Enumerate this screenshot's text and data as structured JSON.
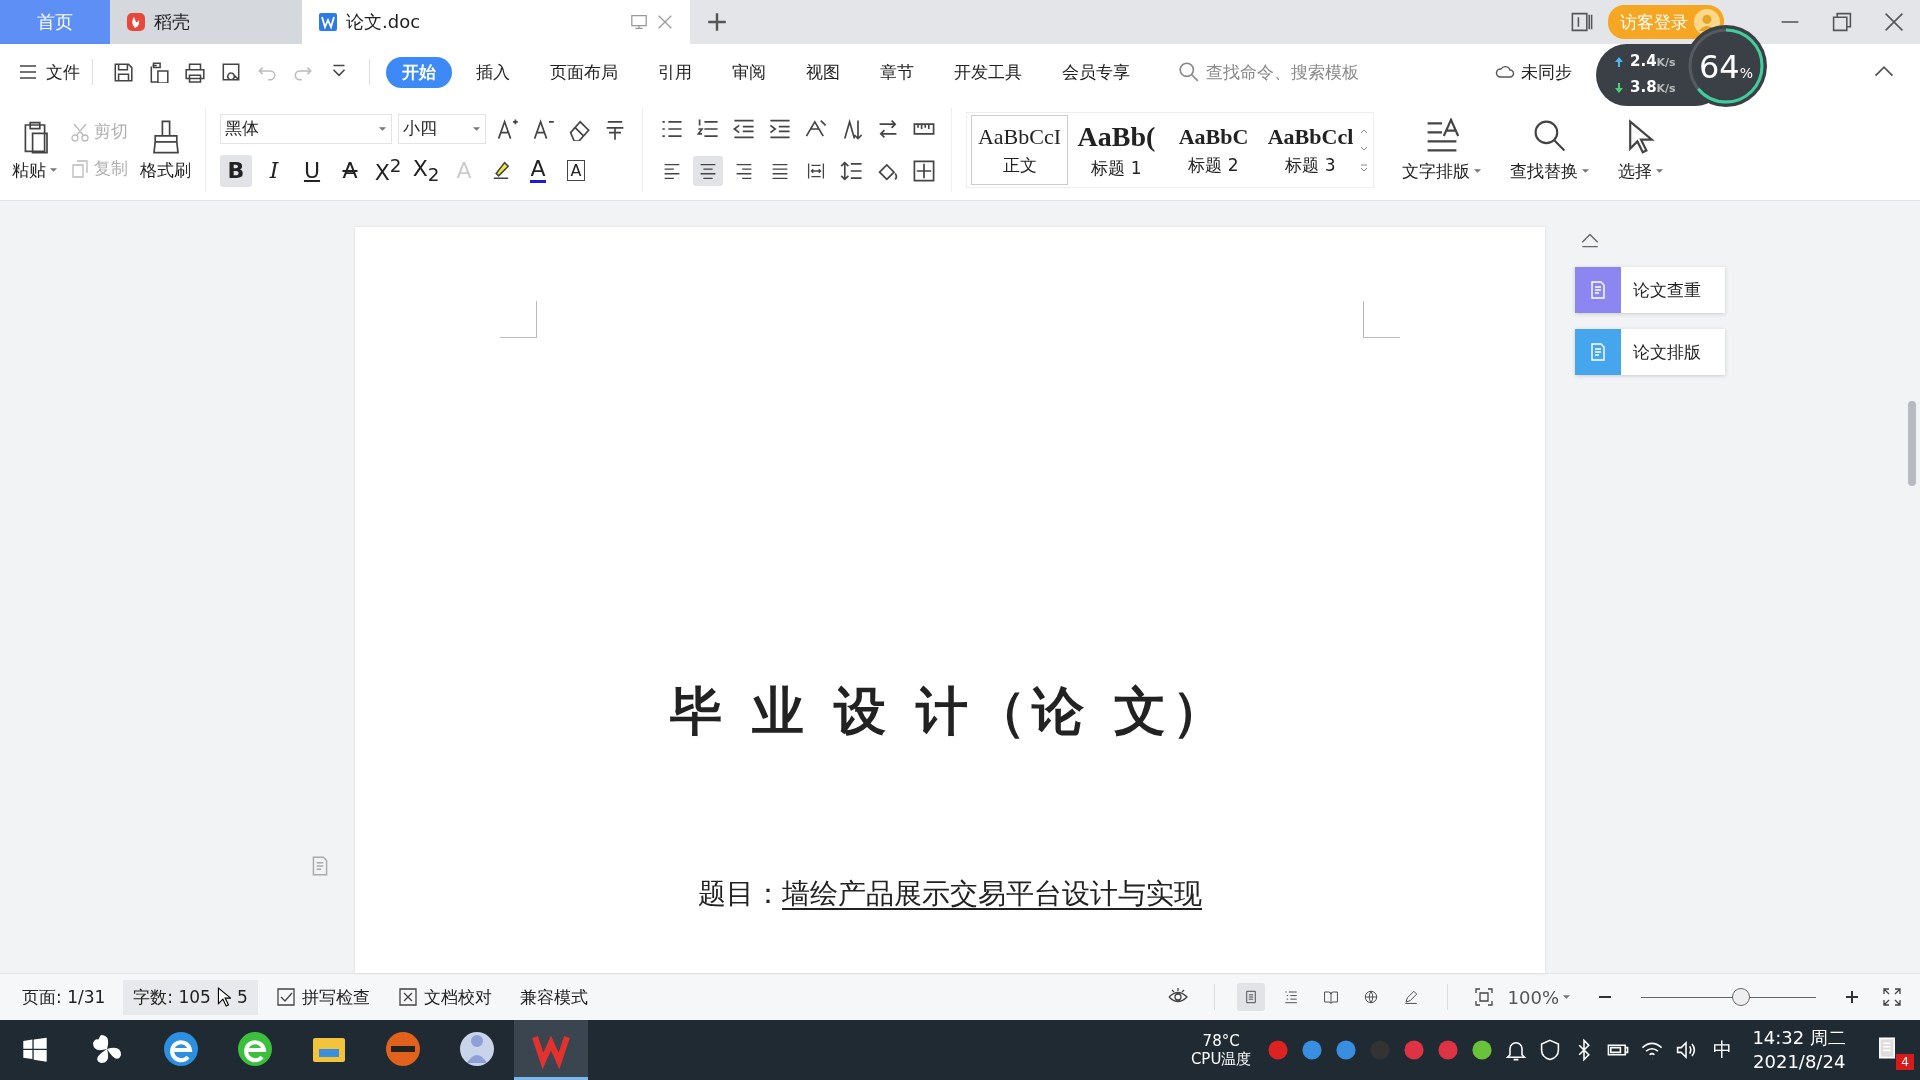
{
  "tabs": [
    {
      "kind": "home",
      "label": "首页",
      "selected": false
    },
    {
      "kind": "docer",
      "label": "稻壳",
      "selected": false
    },
    {
      "kind": "doc",
      "label": "论文.doc",
      "selected": true
    }
  ],
  "login": "访客登录",
  "menu": {
    "file": "文件",
    "tabs": [
      {
        "label": "开始",
        "selected": true
      },
      {
        "label": "插入",
        "selected": false
      },
      {
        "label": "页面布局",
        "selected": false
      },
      {
        "label": "引用",
        "selected": false
      },
      {
        "label": "审阅",
        "selected": false
      },
      {
        "label": "视图",
        "selected": false
      },
      {
        "label": "章节",
        "selected": false
      },
      {
        "label": "开发工具",
        "selected": false
      },
      {
        "label": "会员专享",
        "selected": false
      }
    ],
    "search": {
      "placeholder": "查找命令、搜索模板"
    },
    "sync": "未同步"
  },
  "net": {
    "up": "2.4",
    "up_unit": "K/s",
    "down": "3.8",
    "down_unit": "K/s",
    "percent": "64",
    "sign": "%"
  },
  "ribbon": {
    "paste": "粘贴",
    "cut": "剪切",
    "copy": "复制",
    "painter": "格式刷",
    "font": "黑体",
    "size": "小四",
    "format": [
      {
        "kind": "bold",
        "glyph": "B",
        "selected": true
      },
      {
        "kind": "italic",
        "glyph": "I",
        "selected": false
      },
      {
        "kind": "underline",
        "glyph": "U",
        "selected": false
      },
      {
        "kind": "strike",
        "glyph": "A",
        "selected": false
      },
      {
        "kind": "plain",
        "glyph": "X$^{2}$",
        "selected": false
      },
      {
        "kind": "plain",
        "glyph": "X$_{2}$",
        "selected": false
      },
      {
        "kind": "outline",
        "glyph": "A",
        "selected": false
      },
      {
        "kind": "color",
        "glyph": "A",
        "selected": false
      },
      {
        "kind": "boxed",
        "glyph": "A",
        "selected": false
      }
    ],
    "align": [
      {
        "kind": "left",
        "selected": false
      },
      {
        "kind": "center",
        "selected": true
      },
      {
        "kind": "right",
        "selected": false
      },
      {
        "kind": "justify",
        "selected": false
      },
      {
        "kind": "distribute",
        "selected": false
      }
    ],
    "styles": [
      {
        "kind": "normal",
        "sample": "AaBbCcI",
        "label": "正文",
        "selected": true
      },
      {
        "kind": "h1",
        "sample": "AaBb(",
        "label": "标题 1",
        "selected": false
      },
      {
        "kind": "h2",
        "sample": "AaBbC",
        "label": "标题 2",
        "selected": false
      },
      {
        "kind": "h3",
        "sample": "AaBbCcl",
        "label": "标题 3",
        "selected": false
      }
    ],
    "tools": [
      {
        "kind": "layout",
        "label": "文字排版"
      },
      {
        "kind": "find",
        "label": "查找替换"
      },
      {
        "kind": "select",
        "label": "选择"
      }
    ]
  },
  "panel": [
    {
      "label": "论文查重",
      "color": "#8c86f2"
    },
    {
      "label": "论文排版",
      "color": "#45a6ee"
    }
  ],
  "document": {
    "title": "毕 业 设 计（论 文）",
    "subject_label": "题目：",
    "subject": "墙绘产品展示交易平台设计与实现"
  },
  "status": {
    "page": "页面: 1/31",
    "words": "字数: 105",
    "words_tail": "5",
    "spell": "拼写检查",
    "proof": "文档校对",
    "mode": "兼容模式",
    "zoom": "100%",
    "views": [
      {
        "kind": "page",
        "selected": true
      },
      {
        "kind": "outline",
        "selected": false
      },
      {
        "kind": "read",
        "selected": false
      },
      {
        "kind": "web",
        "selected": false
      },
      {
        "kind": "write",
        "selected": false
      }
    ],
    "slider": {
      "level": 0.57
    }
  },
  "taskbar": {
    "apps": [
      {
        "kind": "fan",
        "selected": false
      },
      {
        "kind": "ie",
        "selected": false
      },
      {
        "kind": "browser",
        "selected": false
      },
      {
        "kind": "folder",
        "selected": false
      },
      {
        "kind": "mask",
        "selected": false
      },
      {
        "kind": "avatar",
        "selected": false
      },
      {
        "kind": "wps",
        "selected": true
      }
    ],
    "temp": "78°C",
    "temp_label": "CPU温度",
    "ime": "中",
    "time": "14:32 周二",
    "date": "2021/8/24",
    "badge": "4"
  }
}
